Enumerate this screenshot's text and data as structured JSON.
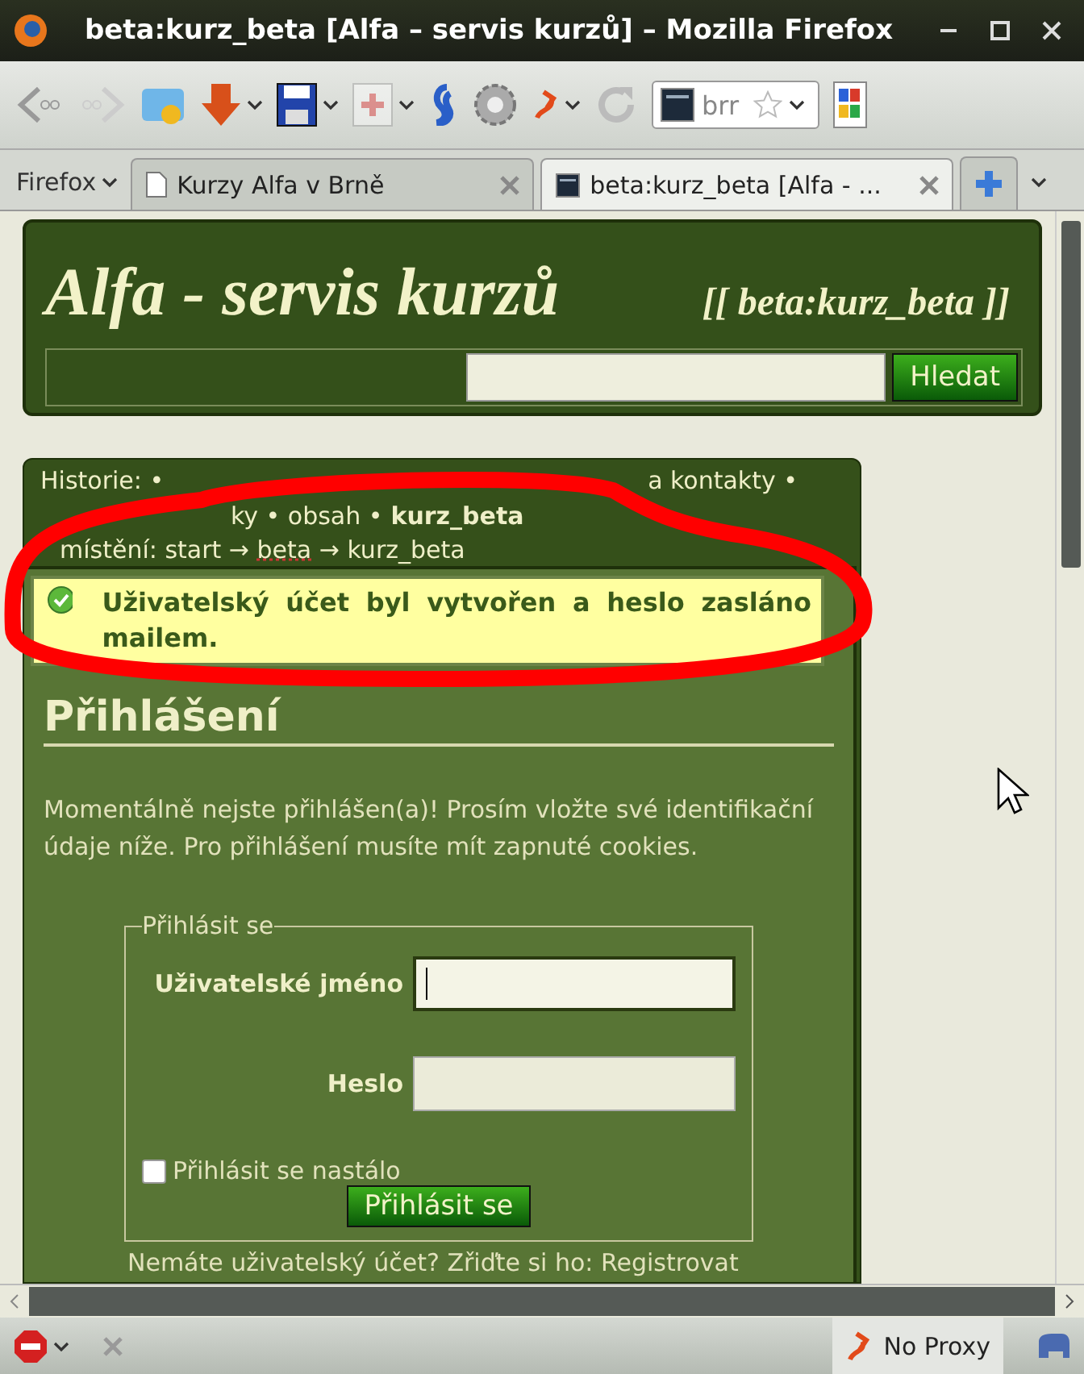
{
  "window": {
    "title": "beta:kurz_beta [Alfa – servis kurzů] – Mozilla Firefox"
  },
  "toolbar": {
    "url_field": {
      "value": "brr"
    }
  },
  "tabs": {
    "menu_label": "Firefox",
    "items": [
      {
        "label": "Kurzy Alfa v Brně",
        "selected": false,
        "kind": "page"
      },
      {
        "label": "beta:kurz_beta [Alfa - ...",
        "selected": true,
        "kind": "site"
      }
    ]
  },
  "page": {
    "site_title": "Alfa - servis kurzů",
    "page_tag": "[[ beta:kurz_beta ]]",
    "search": {
      "button": "Hledat"
    },
    "history": [
      {
        "start": "Historie: •",
        "end": "a  kontakty •"
      },
      {
        "end": "ky • obsah •",
        "current": "kurz_beta"
      }
    ],
    "location": {
      "label": "místění: start →",
      "link": "beta",
      "rest": "→ kurz_beta"
    },
    "message": {
      "kind": "success",
      "text": "Uživatelský účet byl vytvořen a heslo zasláno mailem."
    },
    "login": {
      "heading": "Přihlášení",
      "intro": "Momentálně nejste přihlášen(a)! Prosím vložte své identifikační údaje níže. Pro přihlášení musíte mít zapnuté cookies.",
      "legend": "Přihlásit se",
      "fields": [
        {
          "label": "Uživatelské jméno",
          "focused": true
        },
        {
          "label": "Heslo",
          "focused": false
        }
      ],
      "remember": {
        "label": "Přihlásit se nastálo",
        "checked": false
      },
      "submit": "Přihlásit se",
      "register": "Nemáte uživatelský účet? Zřiďte si ho: Registrovat"
    }
  },
  "status_bar": {
    "proxy": "No Proxy"
  }
}
